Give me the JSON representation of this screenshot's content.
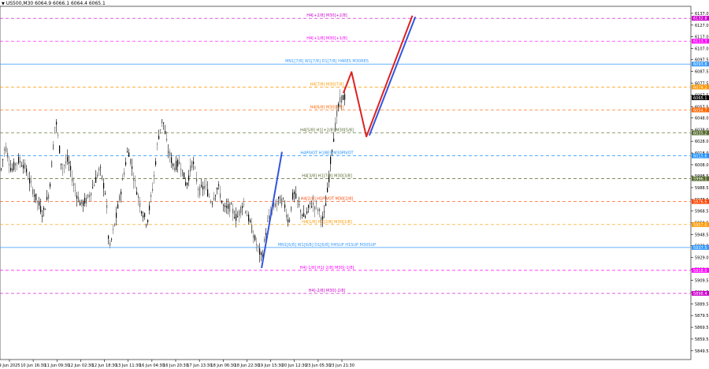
{
  "chart_data": {
    "type": "candlestick",
    "title": "US500,M30 6064.9 6066.1 6064.4 6065.1",
    "symbol": "US500,M30",
    "ohlc": {
      "open": "6064.9",
      "high": "6066.1",
      "low": "6064.4",
      "close": "6065.1"
    },
    "ylim": [
      5842.0,
      6143.0
    ],
    "y_ticks": [
      "6137.0",
      "6127.0",
      "6117.0",
      "6107.0",
      "6097.5",
      "6087.5",
      "6077.5",
      "6067.5",
      "6057.5",
      "6048.0",
      "6038.0",
      "6028.0",
      "6018.0",
      "6008.0",
      "5998.5",
      "5988.5",
      "5978.5",
      "5968.5",
      "5958.5",
      "5948.5",
      "5939.0",
      "5929.0",
      "5919.0",
      "5909.5",
      "5899.5",
      "5889.5",
      "5879.5",
      "5869.5",
      "5859.5",
      "5849.5"
    ],
    "x_ticks": [
      "9 Jun 2025",
      "10 Jun 16:30",
      "11 Jun 09:30",
      "12 Jun 02:30",
      "12 Jun 18:30",
      "13 Jun 11:30",
      "16 Jun 04:30",
      "16 Jun 20:30",
      "17 Jun 13:30",
      "18 Jun 06:30",
      "18 Jun 22:30",
      "19 Jun 15:30",
      "20 Jun 12:30",
      "23 Jun 05:30",
      "23 Jun 21:30"
    ],
    "levels": [
      {
        "label": "H4[+2/8] M30[+2/8]",
        "value": 6132.8,
        "price": "6132.8",
        "color": "#cc00cc",
        "style": "dashed"
      },
      {
        "label": "H4[+1/8] M30[+1/8]",
        "value": 6113.3,
        "price": "6113.3",
        "color": "#ff00ff",
        "style": "dashed"
      },
      {
        "label": "MN1[7/8] W1[7/8] D1[7/8] H4RES M30RES",
        "value": 6093.8,
        "price": "6093.8",
        "color": "#3399ff",
        "style": "solid"
      },
      {
        "label": "H4[7/8] M30[7/8]",
        "value": 6074.2,
        "price": "6074.2",
        "color": "#ff9900",
        "style": "dashed"
      },
      {
        "label": "",
        "value": 6065.1,
        "price": "6065.1",
        "color": "#000000",
        "style": "none"
      },
      {
        "label": "H4[6/8] M30[6/8]",
        "value": 6054.7,
        "price": "6054.7",
        "color": "#ff6600",
        "style": "dashed"
      },
      {
        "label": "H4[5/8] H1[+2/8] M30[5/8]",
        "value": 6035.2,
        "price": "6035.2",
        "color": "#556b2f",
        "style": "dashed"
      },
      {
        "label": "H4PIVOT H1RES M30PIVOT",
        "value": 6015.6,
        "price": "6015.6",
        "color": "#1e90ff",
        "style": "dashed"
      },
      {
        "label": "H4[3/8] H1[7/8] M30[3/8]",
        "value": 5996.1,
        "price": "5996.1",
        "color": "#556b2f",
        "style": "dashed"
      },
      {
        "label": "H4[2/8] H1PIVOT M30[2/8]",
        "value": 5976.6,
        "price": "5976.6",
        "color": "#ff4500",
        "style": "dashed"
      },
      {
        "label": "H4[1/8] H1[2/8] M30[1/8]",
        "value": 5957.0,
        "price": "5957.0",
        "color": "#ff9900",
        "style": "dashed"
      },
      {
        "label": "MN1[6/8] W1[6/8] D1[6/8] H4SUP H1SUP M30SUP",
        "value": 5937.5,
        "price": "5937.5",
        "color": "#3399ff",
        "style": "solid"
      },
      {
        "label": "H4[-1/8] H1[-2/8] M30[-1/8]",
        "value": 5918.0,
        "price": "5918.0",
        "color": "#ff00ff",
        "style": "dashed"
      },
      {
        "label": "H4[-2/8] M30[-2/8]",
        "value": 5898.4,
        "price": "5898.4",
        "color": "#cc00cc",
        "style": "dashed"
      }
    ],
    "projection_lines": [
      {
        "color": "#3355dd",
        "points": [
          [
            5920.0,
            "19 Jun 09:00"
          ],
          [
            6019.0,
            "20 Jun 01:30"
          ]
        ]
      },
      {
        "color": "#dd2222",
        "points": [
          [
            6069.0,
            "23 Jun 22:30"
          ],
          [
            6087.0,
            "24 Jun 04:00"
          ],
          [
            6032.0,
            "24 Jun 14:00"
          ],
          [
            6135.0,
            "25 Jun 21:00"
          ]
        ]
      },
      {
        "color": "#3355dd",
        "points": [
          [
            6033.0,
            "24 Jun 16:00"
          ],
          [
            6134.0,
            "25 Jun 23:00"
          ]
        ]
      }
    ],
    "colors": {
      "background": "#ffffff",
      "candle": "#000000",
      "text": "#000000"
    }
  }
}
